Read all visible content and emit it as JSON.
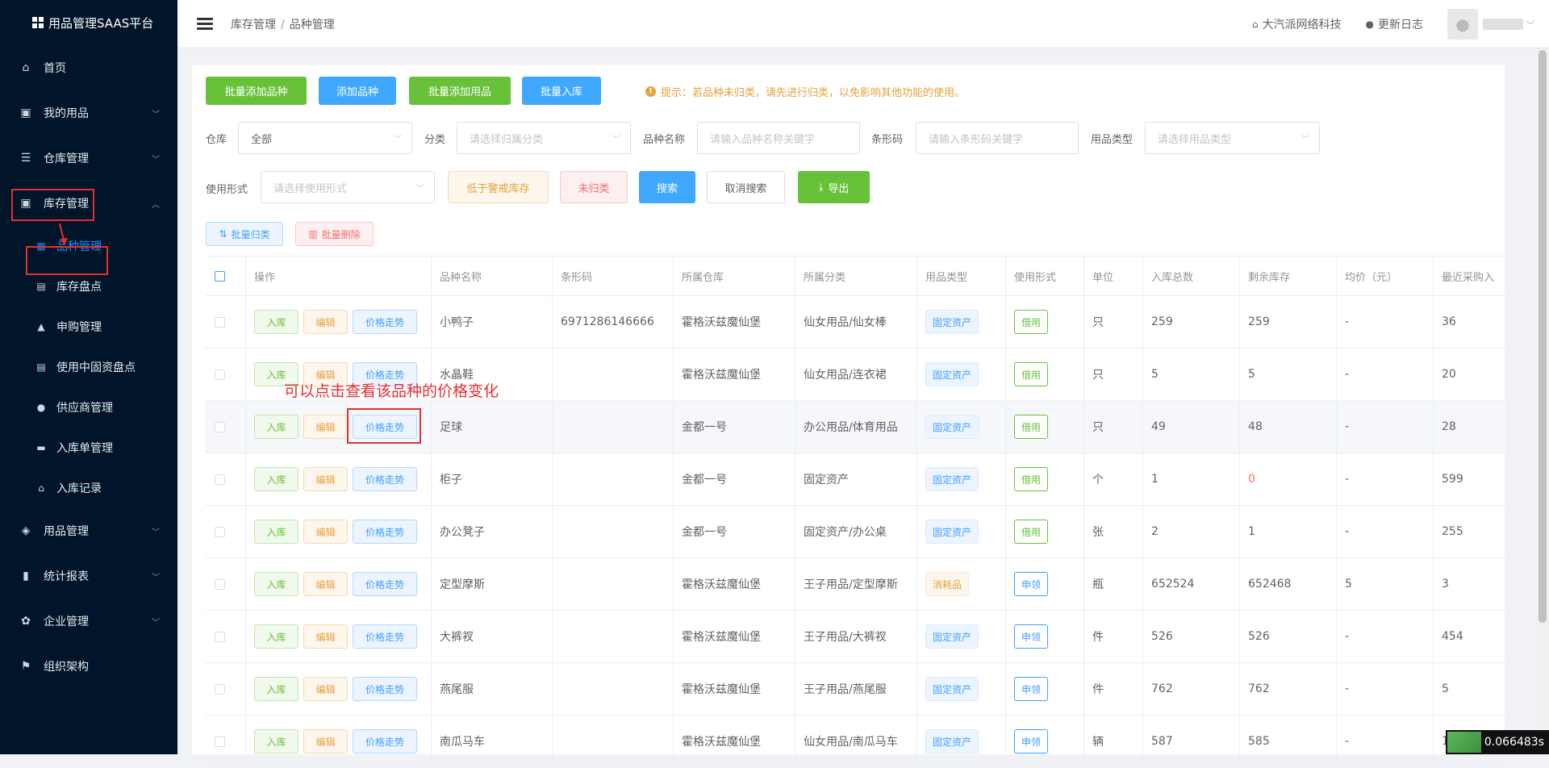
{
  "app": {
    "title": "用品管理SAAS平台"
  },
  "sidebar": {
    "items": [
      {
        "label": "首页",
        "icon": "home-icon"
      },
      {
        "label": "我的用品",
        "icon": "bag-icon"
      },
      {
        "label": "仓库管理",
        "icon": "database-icon"
      },
      {
        "label": "库存管理",
        "icon": "inventory-icon"
      },
      {
        "label": "用品管理",
        "icon": "package-icon"
      },
      {
        "label": "统计报表",
        "icon": "bar-chart-icon"
      },
      {
        "label": "企业管理",
        "icon": "gear-icon"
      },
      {
        "label": "组织架构",
        "icon": "flag-icon"
      }
    ],
    "subitems": [
      {
        "label": "品种管理",
        "icon": "grid-icon"
      },
      {
        "label": "库存盘点",
        "icon": "document-icon"
      },
      {
        "label": "申购管理",
        "icon": "lock-icon"
      },
      {
        "label": "使用中固资盘点",
        "icon": "document-icon"
      },
      {
        "label": "供应商管理",
        "icon": "user-icon"
      },
      {
        "label": "入库单管理",
        "icon": "folder-icon"
      },
      {
        "label": "入库记录",
        "icon": "home-icon"
      }
    ]
  },
  "header": {
    "breadcrumb": [
      "库存管理",
      "品种管理"
    ],
    "company": "大汽派网络科技",
    "changelog": "更新日志"
  },
  "toolbar": {
    "batch_add_variety": "批量添加品种",
    "add_variety": "添加品种",
    "batch_add_goods": "批量添加用品",
    "batch_stock_in": "批量入库",
    "tip": "提示：若品种未归类，请先进行归类，以免影响其他功能的使用。"
  },
  "filters": {
    "warehouse_label": "仓库",
    "warehouse_value": "全部",
    "category_label": "分类",
    "category_placeholder": "请选择归属分类",
    "name_label": "品种名称",
    "name_placeholder": "请输入品种名称关键字",
    "barcode_label": "条形码",
    "barcode_placeholder": "请输入条形码关键字",
    "type_label": "用品类型",
    "type_placeholder": "请选择用品类型",
    "usage_label": "使用形式",
    "usage_placeholder": "请选择使用形式",
    "below_warning": "低于警戒库存",
    "unclassified": "未归类",
    "search": "搜索",
    "cancel_search": "取消搜索",
    "export": "导出"
  },
  "batch": {
    "classify": "批量归类",
    "delete": "批量删除"
  },
  "table": {
    "headers": [
      "操作",
      "品种名称",
      "条形码",
      "所属仓库",
      "所属分类",
      "用品类型",
      "使用形式",
      "单位",
      "入库总数",
      "剩余库存",
      "均价（元）",
      "最近采购入"
    ],
    "op_labels": {
      "in": "入库",
      "edit": "编辑",
      "price": "价格走势"
    },
    "rows": [
      {
        "name": "小鸭子",
        "barcode": "6971286146666",
        "warehouse": "霍格沃兹魔仙堡",
        "category": "仙女用品/仙女棒",
        "type": "固定资产",
        "usage": "借用",
        "unit": "只",
        "total": "259",
        "remain": "259",
        "avg": "-",
        "recent": "36"
      },
      {
        "name": "水晶鞋",
        "barcode": "",
        "warehouse": "霍格沃兹魔仙堡",
        "category": "仙女用品/连衣裙",
        "type": "固定资产",
        "usage": "借用",
        "unit": "只",
        "total": "5",
        "remain": "5",
        "avg": "-",
        "recent": "20"
      },
      {
        "name": "足球",
        "barcode": "",
        "warehouse": "金都一号",
        "category": "办公用品/体育用品",
        "type": "固定资产",
        "usage": "借用",
        "unit": "只",
        "total": "49",
        "remain": "48",
        "avg": "-",
        "recent": "28"
      },
      {
        "name": "柜子",
        "barcode": "",
        "warehouse": "金都一号",
        "category": "固定资产",
        "type": "固定资产",
        "usage": "借用",
        "unit": "个",
        "total": "1",
        "remain": "0",
        "avg": "-",
        "recent": "599"
      },
      {
        "name": "办公凳子",
        "barcode": "",
        "warehouse": "金都一号",
        "category": "固定资产/办公桌",
        "type": "固定资产",
        "usage": "借用",
        "unit": "张",
        "total": "2",
        "remain": "1",
        "avg": "-",
        "recent": "255"
      },
      {
        "name": "定型摩斯",
        "barcode": "",
        "warehouse": "霍格沃兹魔仙堡",
        "category": "王子用品/定型摩斯",
        "type": "消耗品",
        "usage": "申领",
        "unit": "瓶",
        "total": "652524",
        "remain": "652468",
        "avg": "5",
        "recent": "3"
      },
      {
        "name": "大裤衩",
        "barcode": "",
        "warehouse": "霍格沃兹魔仙堡",
        "category": "王子用品/大裤衩",
        "type": "固定资产",
        "usage": "申领",
        "unit": "件",
        "total": "526",
        "remain": "526",
        "avg": "-",
        "recent": "454"
      },
      {
        "name": "燕尾服",
        "barcode": "",
        "warehouse": "霍格沃兹魔仙堡",
        "category": "王子用品/燕尾服",
        "type": "固定资产",
        "usage": "申领",
        "unit": "件",
        "total": "762",
        "remain": "762",
        "avg": "-",
        "recent": "5"
      },
      {
        "name": "南瓜马车",
        "barcode": "",
        "warehouse": "霍格沃兹魔仙堡",
        "category": "仙女用品/南瓜马车",
        "type": "固定资产",
        "usage": "申领",
        "unit": "辆",
        "total": "587",
        "remain": "585",
        "avg": "-",
        "recent": "1"
      }
    ]
  },
  "annotation": "可以点击查看该品种的价格变化",
  "timer": "0.066483s"
}
